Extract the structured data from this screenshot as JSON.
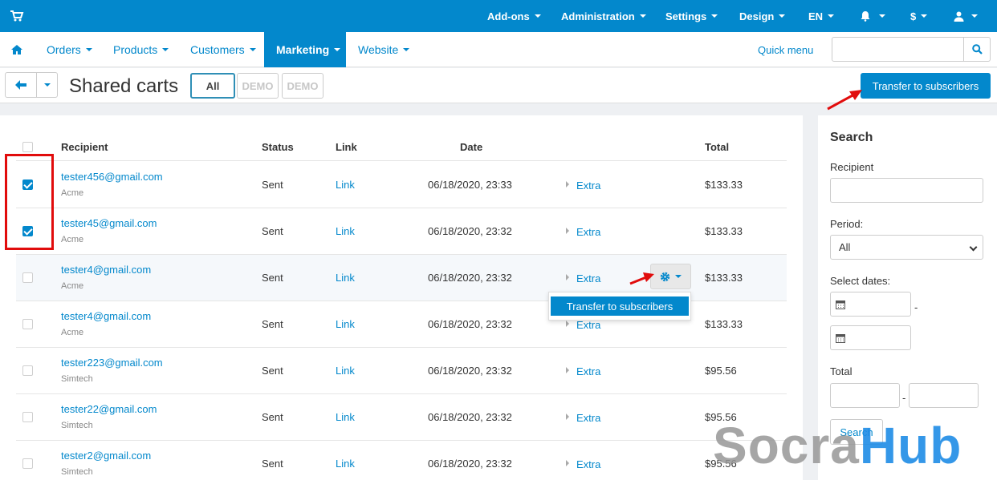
{
  "topbar": {
    "items": [
      {
        "label": "Add-ons"
      },
      {
        "label": "Administration"
      },
      {
        "label": "Settings"
      },
      {
        "label": "Design"
      },
      {
        "label": "EN"
      },
      {
        "label": "$"
      }
    ]
  },
  "mainnav": {
    "items": [
      {
        "label": "Orders"
      },
      {
        "label": "Products"
      },
      {
        "label": "Customers"
      },
      {
        "label": "Marketing"
      },
      {
        "label": "Website"
      }
    ],
    "quick_menu": "Quick menu",
    "search_placeholder": ""
  },
  "page": {
    "title": "Shared carts",
    "tabs": [
      {
        "label": "All"
      },
      {
        "label": "DEMO"
      },
      {
        "label": "DEMO"
      }
    ],
    "transfer_button": "Transfer to subscribers"
  },
  "table": {
    "headers": {
      "recipient": "Recipient",
      "status": "Status",
      "link": "Link",
      "date": "Date",
      "total": "Total"
    },
    "rows": [
      {
        "email": "tester456@gmail.com",
        "company": "Acme",
        "status": "Sent",
        "link": "Link",
        "date": "06/18/2020, 23:33",
        "extra": "Extra",
        "total": "$133.33",
        "checked": true
      },
      {
        "email": "tester45@gmail.com",
        "company": "Acme",
        "status": "Sent",
        "link": "Link",
        "date": "06/18/2020, 23:32",
        "extra": "Extra",
        "total": "$133.33",
        "checked": true
      },
      {
        "email": "tester4@gmail.com",
        "company": "Acme",
        "status": "Sent",
        "link": "Link",
        "date": "06/18/2020, 23:32",
        "extra": "Extra",
        "total": "$133.33",
        "checked": false
      },
      {
        "email": "tester4@gmail.com",
        "company": "Acme",
        "status": "Sent",
        "link": "Link",
        "date": "06/18/2020, 23:32",
        "extra": "Extra",
        "total": "$133.33",
        "checked": false
      },
      {
        "email": "tester223@gmail.com",
        "company": "Simtech",
        "status": "Sent",
        "link": "Link",
        "date": "06/18/2020, 23:32",
        "extra": "Extra",
        "total": "$95.56",
        "checked": false
      },
      {
        "email": "tester22@gmail.com",
        "company": "Simtech",
        "status": "Sent",
        "link": "Link",
        "date": "06/18/2020, 23:32",
        "extra": "Extra",
        "total": "$95.56",
        "checked": false
      },
      {
        "email": "tester2@gmail.com",
        "company": "Simtech",
        "status": "Sent",
        "link": "Link",
        "date": "06/18/2020, 23:32",
        "extra": "Extra",
        "total": "$95.56",
        "checked": false
      }
    ],
    "row_menu_item": "Transfer to subscribers"
  },
  "sidebar": {
    "title": "Search",
    "recipient_label": "Recipient",
    "period_label": "Period:",
    "period_value": "All",
    "select_dates_label": "Select dates:",
    "date_separator": "-",
    "total_label": "Total",
    "total_separator": "-",
    "search_button": "Search"
  },
  "watermark": {
    "part1": "Socra",
    "part2": "Hub"
  },
  "colors": {
    "brand": "#0388cc",
    "annotation": "#e10c0c"
  }
}
